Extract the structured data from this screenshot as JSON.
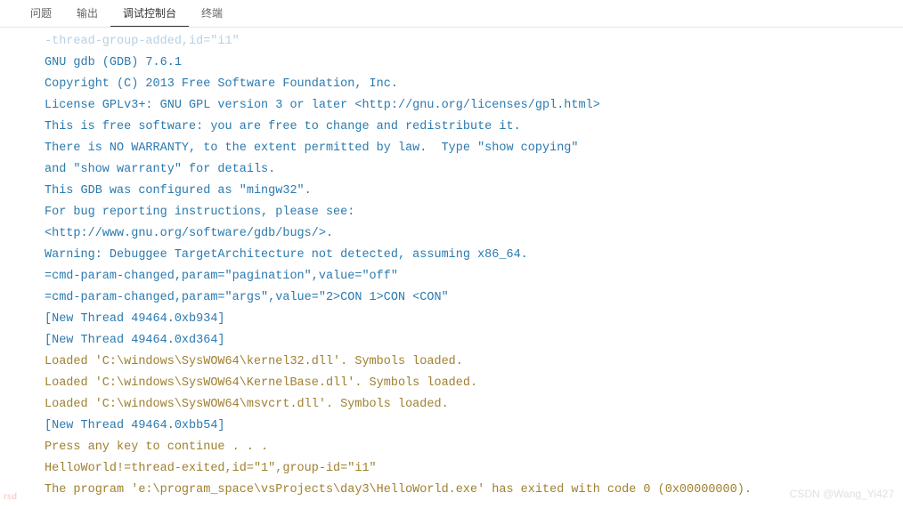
{
  "tabs": {
    "items": [
      {
        "label": "问题"
      },
      {
        "label": "输出"
      },
      {
        "label": "调试控制台"
      },
      {
        "label": "终端"
      }
    ],
    "activeIndex": 2
  },
  "console": {
    "lines": [
      {
        "text": "-thread-group-added,id=\"i1\"",
        "cls": "line-blue",
        "faded": true
      },
      {
        "text": "GNU gdb (GDB) 7.6.1",
        "cls": "line-blue"
      },
      {
        "text": "Copyright (C) 2013 Free Software Foundation, Inc.",
        "cls": "line-blue"
      },
      {
        "text": "License GPLv3+: GNU GPL version 3 or later <http://gnu.org/licenses/gpl.html>",
        "cls": "line-blue"
      },
      {
        "text": "This is free software: you are free to change and redistribute it.",
        "cls": "line-blue"
      },
      {
        "text": "There is NO WARRANTY, to the extent permitted by law.  Type \"show copying\"",
        "cls": "line-blue"
      },
      {
        "text": "and \"show warranty\" for details.",
        "cls": "line-blue"
      },
      {
        "text": "This GDB was configured as \"mingw32\".",
        "cls": "line-blue"
      },
      {
        "text": "For bug reporting instructions, please see:",
        "cls": "line-blue"
      },
      {
        "text": "<http://www.gnu.org/software/gdb/bugs/>.",
        "cls": "line-blue"
      },
      {
        "text": "Warning: Debuggee TargetArchitecture not detected, assuming x86_64.",
        "cls": "line-blue"
      },
      {
        "text": "=cmd-param-changed,param=\"pagination\",value=\"off\"",
        "cls": "line-blue"
      },
      {
        "text": "=cmd-param-changed,param=\"args\",value=\"2>CON 1>CON <CON\"",
        "cls": "line-blue"
      },
      {
        "text": "[New Thread 49464.0xb934]",
        "cls": "line-blue"
      },
      {
        "text": "[New Thread 49464.0xd364]",
        "cls": "line-blue"
      },
      {
        "text": "Loaded 'C:\\windows\\SysWOW64\\kernel32.dll'. Symbols loaded.",
        "cls": "line-olive"
      },
      {
        "text": "Loaded 'C:\\windows\\SysWOW64\\KernelBase.dll'. Symbols loaded.",
        "cls": "line-olive"
      },
      {
        "text": "Loaded 'C:\\windows\\SysWOW64\\msvcrt.dll'. Symbols loaded.",
        "cls": "line-olive"
      },
      {
        "text": "[New Thread 49464.0xbb54]",
        "cls": "line-blue"
      },
      {
        "text": "Press any key to continue . . .",
        "cls": "line-olive"
      },
      {
        "text": "HelloWorld!=thread-exited,id=\"1\",group-id=\"i1\"",
        "cls": "line-olive"
      },
      {
        "text": "The program 'e:\\program_space\\vsProjects\\day3\\HelloWorld.exe' has exited with code 0 (0x00000000).",
        "cls": "line-olive"
      }
    ]
  },
  "watermark": "rsd",
  "watermark2": "CSDN @Wang_Yi427"
}
